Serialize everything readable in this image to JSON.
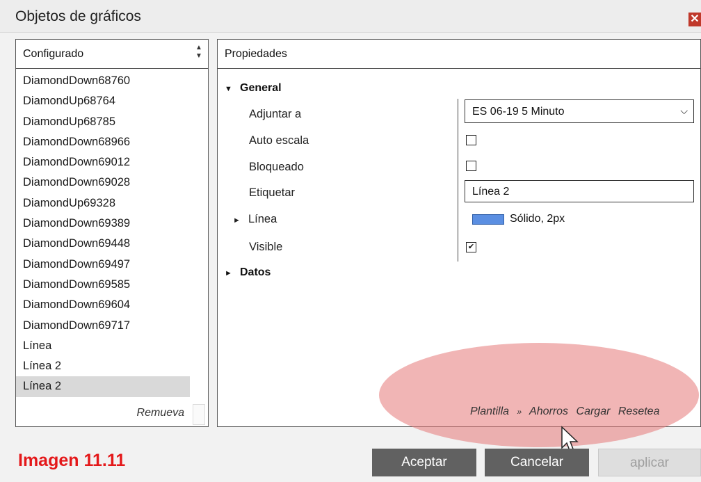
{
  "window": {
    "title": "Objetos de gráficos"
  },
  "left_panel": {
    "header": "Configurado",
    "items": [
      "DiamondDown68760",
      "DiamondUp68764",
      "DiamondUp68785",
      "DiamondDown68966",
      "DiamondDown69012",
      "DiamondDown69028",
      "DiamondUp69328",
      "DiamondDown69389",
      "DiamondDown69448",
      "DiamondDown69497",
      "DiamondDown69585",
      "DiamondDown69604",
      "DiamondDown69717",
      "Línea",
      "Línea 2",
      "Línea 2"
    ],
    "selected_index": 15,
    "remove_label": "Remueva"
  },
  "right_panel": {
    "header": "Propiedades",
    "general_label": "General",
    "data_label": "Datos",
    "props": {
      "attach_label": "Adjuntar a",
      "attach_value": "ES 06-19 5 Minuto",
      "auto_scale_label": "Auto escala",
      "auto_scale_checked": false,
      "locked_label": "Bloqueado",
      "locked_checked": false,
      "tag_label": "Etiquetar",
      "tag_value": "Línea 2",
      "line_label": "Línea",
      "line_value": "Sólido, 2px",
      "line_color": "#5b8fe2",
      "visible_label": "Visible",
      "visible_checked": true
    }
  },
  "template": {
    "label": "Plantilla",
    "separator": "»",
    "save": "Ahorros",
    "load": "Cargar",
    "reset": "Resetea"
  },
  "buttons": {
    "accept": "Aceptar",
    "cancel": "Cancelar",
    "apply": "aplicar"
  },
  "watermark": "Imagen 11.11",
  "icons": {
    "close": "close-icon",
    "sort": "sort-arrows-icon",
    "dropdown": "chevron-down-icon",
    "expand": "triangle-right-icon",
    "collapse": "triangle-down-icon",
    "cursor": "pointer-cursor-icon"
  }
}
